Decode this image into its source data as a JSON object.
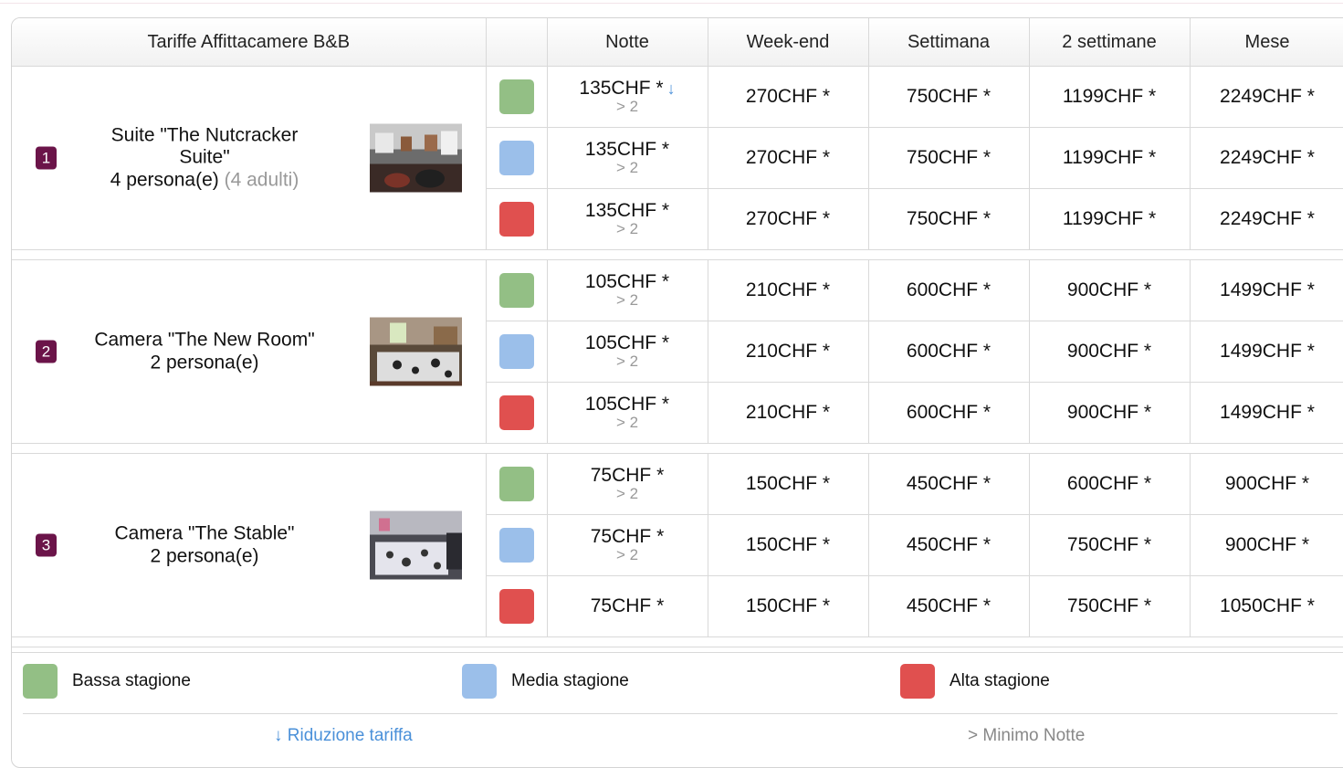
{
  "header": {
    "title": "Tariffe Affittacamere B&B",
    "columns": [
      "Notte",
      "Week-end",
      "Settimana",
      "2 settimane",
      "Mese"
    ]
  },
  "seasons": [
    {
      "key": "low",
      "label": "Bassa stagione",
      "color": "#93bf85"
    },
    {
      "key": "mid",
      "label": "Media stagione",
      "color": "#9bbfea"
    },
    {
      "key": "high",
      "label": "Alta stagione",
      "color": "#e0504f"
    }
  ],
  "rooms": [
    {
      "number": "1",
      "name": "Suite \"The Nutcracker Suite\"",
      "capacity": "4 persona(e)",
      "capacity_extra": "(4 adulti)",
      "rows": [
        {
          "night": "135CHF *",
          "min_nights": "> 2",
          "reduction_arrow": "↓",
          "weekend": "270CHF *",
          "week": "750CHF *",
          "two_weeks": "1199CHF *",
          "month": "2249CHF *"
        },
        {
          "night": "135CHF *",
          "min_nights": "> 2",
          "weekend": "270CHF *",
          "week": "750CHF *",
          "two_weeks": "1199CHF *",
          "month": "2249CHF *"
        },
        {
          "night": "135CHF *",
          "min_nights": "> 2",
          "weekend": "270CHF *",
          "week": "750CHF *",
          "two_weeks": "1199CHF *",
          "month": "2249CHF *"
        }
      ]
    },
    {
      "number": "2",
      "name": "Camera \"The New Room\"",
      "capacity": "2 persona(e)",
      "rows": [
        {
          "night": "105CHF *",
          "min_nights": "> 2",
          "weekend": "210CHF *",
          "week": "600CHF *",
          "two_weeks": "900CHF *",
          "month": "1499CHF *"
        },
        {
          "night": "105CHF *",
          "min_nights": "> 2",
          "weekend": "210CHF *",
          "week": "600CHF *",
          "two_weeks": "900CHF *",
          "month": "1499CHF *"
        },
        {
          "night": "105CHF *",
          "min_nights": "> 2",
          "weekend": "210CHF *",
          "week": "600CHF *",
          "two_weeks": "900CHF *",
          "month": "1499CHF *"
        }
      ]
    },
    {
      "number": "3",
      "name": "Camera \"The Stable\"",
      "capacity": "2 persona(e)",
      "rows": [
        {
          "night": "75CHF *",
          "min_nights": "> 2",
          "weekend": "150CHF *",
          "week": "450CHF *",
          "two_weeks": "600CHF *",
          "month": "900CHF *"
        },
        {
          "night": "75CHF *",
          "min_nights": "> 2",
          "weekend": "150CHF *",
          "week": "450CHF *",
          "two_weeks": "750CHF *",
          "month": "900CHF *"
        },
        {
          "night": "75CHF *",
          "weekend": "150CHF *",
          "week": "450CHF *",
          "two_weeks": "750CHF *",
          "month": "1050CHF *"
        }
      ]
    }
  ],
  "legend": {
    "items": [
      "Bassa stagione",
      "Media stagione",
      "Alta stagione"
    ],
    "reduction_note": "↓ Riduzione tariffa",
    "min_note": "> Minimo Notte"
  },
  "colors": {
    "badge": "#6b1449",
    "link": "#4a90d9",
    "muted": "#999999",
    "border": "#d9d9d9"
  }
}
